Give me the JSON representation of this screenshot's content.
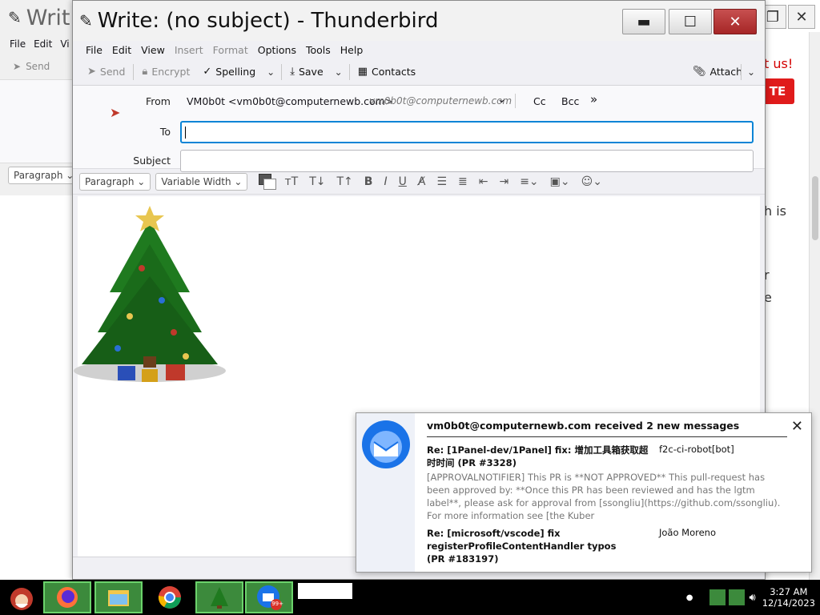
{
  "bg_window": {
    "title": "Writ",
    "menu": [
      "File",
      "Edit",
      "Vi"
    ],
    "toolbar_send": "Send",
    "paragraph": "Paragraph"
  },
  "bg_right": {
    "text1": "t us!",
    "button": "TE",
    "text2": "h is",
    "text3": "r",
    "text4": "e"
  },
  "window": {
    "title": "Write: (no subject) - Thunderbird",
    "menu": [
      {
        "label": "File",
        "dim": false
      },
      {
        "label": "Edit",
        "dim": false
      },
      {
        "label": "View",
        "dim": false
      },
      {
        "label": "Insert",
        "dim": true
      },
      {
        "label": "Format",
        "dim": true
      },
      {
        "label": "Options",
        "dim": false
      },
      {
        "label": "Tools",
        "dim": false
      },
      {
        "label": "Help",
        "dim": false
      }
    ],
    "toolbar": {
      "send": "Send",
      "encrypt": "Encrypt",
      "spelling": "Spelling",
      "save": "Save",
      "contacts": "Contacts",
      "attach": "Attach"
    },
    "headers": {
      "from_label": "From",
      "from_value": "VM0b0t <vm0b0t@computernewb.com>",
      "from_hint": "vm0b0t@computernewb.com",
      "cc": "Cc",
      "bcc": "Bcc",
      "to_label": "To",
      "to_value": "",
      "subject_label": "Subject",
      "subject_value": ""
    },
    "format": {
      "paragraph": "Paragraph",
      "font": "Variable Width"
    }
  },
  "notification": {
    "header": "vm0b0t@computernewb.com received 2 new messages",
    "msg1_subject": "Re: [1Panel-dev/1Panel] fix: 增加工具箱获取超时时间 (PR #3328)",
    "msg1_sender": "f2c-ci-robot[bot]",
    "msg1_preview": "[APPROVALNOTIFIER] This PR is **NOT APPROVED** This pull-request has been approved by: **Once this PR has been reviewed and has the lgtm label**, please ask for approval from [ssongliu](https://github.com/ssongliu). For more information see [the Kuber",
    "msg2_subject": "Re: [microsoft/vscode] fix registerProfileContentHandler typos (PR #183197)",
    "msg2_sender": "João Moreno"
  },
  "taskbar": {
    "time": "3:27 AM",
    "date": "12/14/2023",
    "badge": "99+"
  }
}
